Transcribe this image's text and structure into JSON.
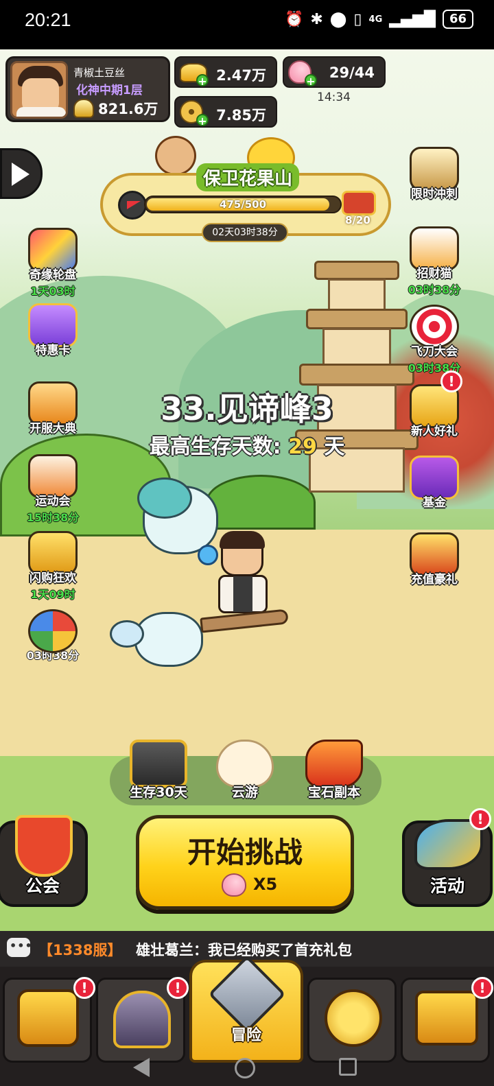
{
  "status_bar": {
    "time": "20:21",
    "network": "4G",
    "battery": "66"
  },
  "profile": {
    "name": "青椒土豆丝",
    "rank": "化神中期1层",
    "power": "821.6万"
  },
  "resources": {
    "gold": "2.47万",
    "stamina": "29/44",
    "stamina_timer": "14:34",
    "coins": "7.85万"
  },
  "event": {
    "title": "保卫花果山",
    "progress_text": "475/500",
    "progress_value": 475,
    "progress_max": 500,
    "chest_count": "8/20",
    "countdown": "02天03时38分"
  },
  "left_menu": [
    {
      "label": "奇缘轮盘",
      "timer": "1天03时"
    },
    {
      "label": "特惠卡",
      "timer": ""
    },
    {
      "label": "开服大典",
      "timer": ""
    },
    {
      "label": "运动会",
      "timer": "15时38分"
    },
    {
      "label": "闪购狂欢",
      "timer": "1天09时"
    },
    {
      "label": "",
      "timer": "03时38分"
    }
  ],
  "right_menu": [
    {
      "label": "限时冲刺",
      "timer": ""
    },
    {
      "label": "招财猫",
      "timer": "03时38分"
    },
    {
      "label": "飞刀大会",
      "timer": "03时38分"
    },
    {
      "label": "新人好礼",
      "timer": "",
      "badge": "!"
    },
    {
      "label": "基金",
      "timer": ""
    },
    {
      "label": "充值豪礼",
      "timer": ""
    }
  ],
  "stage": {
    "name": "33.见谛峰3",
    "survive_label": "最高生存天数:",
    "survive_days": "29",
    "survive_unit": "天"
  },
  "modes": [
    {
      "label": "生存30天"
    },
    {
      "label": "云游"
    },
    {
      "label": "宝石副本"
    }
  ],
  "start_button": {
    "label": "开始挑战",
    "cost": "X5"
  },
  "guild": {
    "label": "公会"
  },
  "activity": {
    "label": "活动",
    "badge": "!"
  },
  "chat": {
    "server": "【1338服】",
    "message": "雄壮葛兰：我已经购买了首充礼包"
  },
  "bottom_nav": [
    {
      "label": "",
      "badge": "!"
    },
    {
      "label": "",
      "badge": "!"
    },
    {
      "label": "冒险",
      "badge": ""
    },
    {
      "label": "",
      "badge": ""
    },
    {
      "label": "",
      "badge": "!"
    }
  ],
  "colors": {
    "accent_yellow": "#ffd21a",
    "timer_green": "#4be04b",
    "rank_purple": "#c79cff",
    "server_orange": "#ff8a2a",
    "badge_red": "#e8233a"
  }
}
